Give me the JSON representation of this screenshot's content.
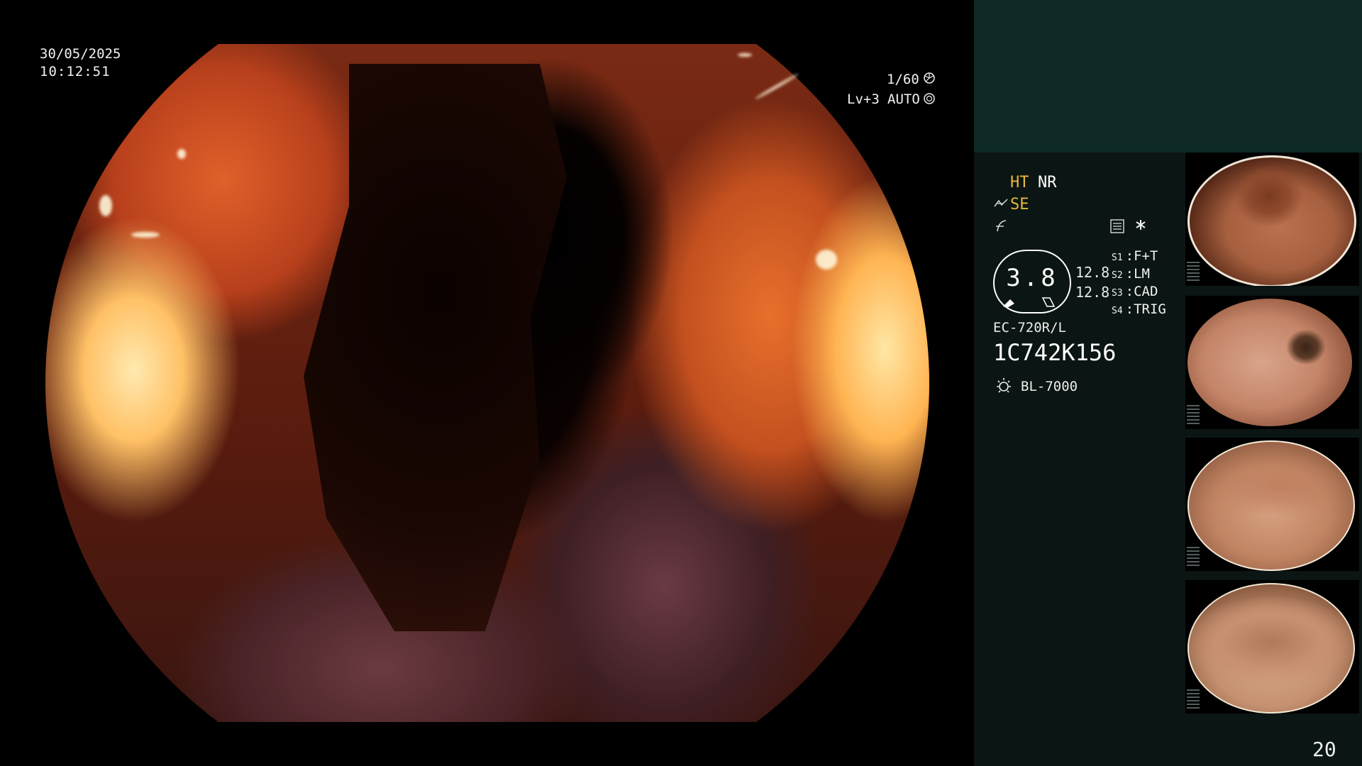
{
  "overlay": {
    "date": "30/05/2025",
    "time": "10:12:51",
    "shutter": "1/60",
    "level": "Lv+3",
    "mode": "AUTO"
  },
  "panel": {
    "ht": "HT",
    "nr": "NR",
    "se": "SE",
    "gauge_value": "3.8",
    "side_value_1": "12.8",
    "side_value_2": "12.8",
    "settings": [
      {
        "key": "S1",
        "value": "F+T"
      },
      {
        "key": "S2",
        "value": "LM"
      },
      {
        "key": "S3",
        "value": "CAD"
      },
      {
        "key": "S4",
        "value": "TRIG"
      }
    ],
    "scope_model": "EC-720R/L",
    "scope_serial": "1C742K156",
    "light_source": "BL-7000"
  },
  "footer": {
    "page_number": "20"
  },
  "colors": {
    "panel_top_bg": "#0f2a26",
    "panel_bg": "#0b1513",
    "accent_yellow": "#e7b83c"
  },
  "icons": [
    "shutter-icon",
    "auto-iris-icon",
    "enhance-icon",
    "structure-icon",
    "list-icon",
    "star-icon",
    "light-source-icon"
  ]
}
